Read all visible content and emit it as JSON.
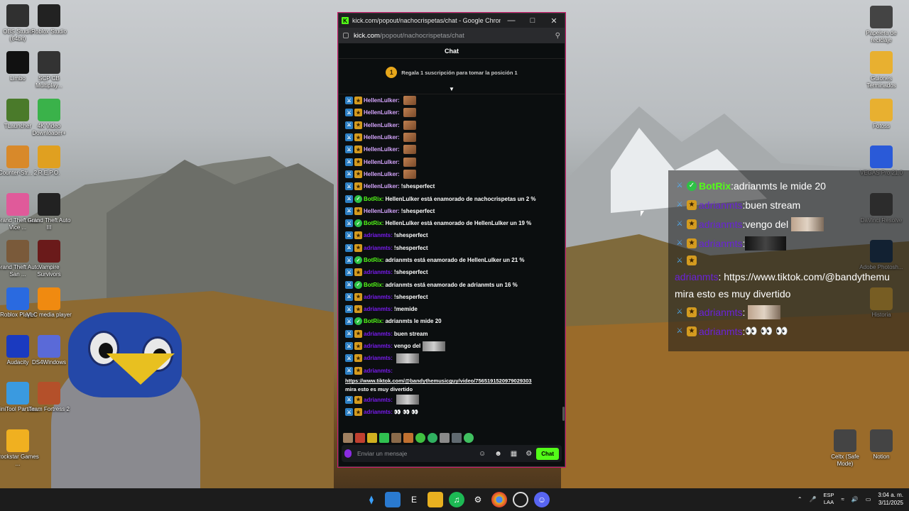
{
  "desktop_icons": [
    {
      "label": "OBS Studio (64bit)",
      "icon": "obs-icon",
      "color": "#303030"
    },
    {
      "label": "Roblox Studio",
      "icon": "roblox-studio-icon",
      "color": "#222"
    },
    {
      "label": "Limbo",
      "icon": "limbo-icon",
      "color": "#111"
    },
    {
      "label": "SCP CB Multiplay...",
      "icon": "scp-icon",
      "color": "#333"
    },
    {
      "label": "TLauncher",
      "icon": "tlauncher-icon",
      "color": "#4a7a2a"
    },
    {
      "label": "4K Video Downloader+",
      "icon": "4k-video-icon",
      "color": "#3ab24a"
    },
    {
      "label": "Counter-Str... 2",
      "icon": "counter-strike-icon",
      "color": "#d8892a"
    },
    {
      "label": "R.E.P.O.",
      "icon": "repo-icon",
      "color": "#e0a020"
    },
    {
      "label": "Grand Theft Auto Vice ...",
      "icon": "gta-vice-icon",
      "color": "#e05a9a"
    },
    {
      "label": "Grand Theft Auto III",
      "icon": "gta-3-icon",
      "color": "#222"
    },
    {
      "label": "Grand Theft Auto San ...",
      "icon": "gta-sa-icon",
      "color": "#7a5a3a"
    },
    {
      "label": "Vampire Survivors",
      "icon": "vampire-survivors-icon",
      "color": "#6a1a1a"
    },
    {
      "label": "Roblox Player",
      "icon": "roblox-player-icon",
      "color": "#2a6ae0"
    },
    {
      "label": "VLC media player",
      "icon": "vlc-icon",
      "color": "#f08a10"
    },
    {
      "label": "Audacity",
      "icon": "audacity-icon",
      "color": "#1a3ac0"
    },
    {
      "label": "DS4Windows",
      "icon": "ds4windows-icon",
      "color": "#5a6ad8"
    },
    {
      "label": "MiniTool Partitio...",
      "icon": "minitool-icon",
      "color": "#3a9ae0"
    },
    {
      "label": "Team Fortress 2",
      "icon": "tf2-icon",
      "color": "#b4502a"
    },
    {
      "label": "Rockstar Games ...",
      "icon": "rockstar-icon",
      "color": "#f0b020"
    }
  ],
  "right_icons": [
    {
      "label": "Papelera de reciclaje",
      "icon": "recycle-bin-icon"
    },
    {
      "label": "Guiones Terminados",
      "icon": "folder-icon"
    },
    {
      "label": "Fotoss",
      "icon": "folder-icon"
    },
    {
      "label": "VEGAS Pro 21.0",
      "icon": "vegas-icon"
    },
    {
      "label": "DaVinci Resolve",
      "icon": "davinci-icon"
    },
    {
      "label": "Adobe Photosh...",
      "icon": "photoshop-icon"
    },
    {
      "label": "Historia",
      "icon": "folder-icon"
    },
    {
      "label": "Celtx (Safe Mode)",
      "icon": "celtx-icon"
    },
    {
      "label": "Notion",
      "icon": "notion-icon"
    }
  ],
  "browser": {
    "title": "kick.com/popout/nachocrispetas/chat - Google Chrome",
    "url_domain": "kick.com",
    "url_path": "/popout/nachocrispetas/chat",
    "chat_header": "Chat",
    "promo_rank": "1",
    "promo_text": "Regala 1 suscripción para tomar la posición 1",
    "input_placeholder": "Enviar un mensaje",
    "send_label": "Chat"
  },
  "chat_messages": [
    {
      "user": "HellenLulker",
      "type": "hel",
      "text": "",
      "emote": true
    },
    {
      "user": "HellenLulker",
      "type": "hel",
      "text": "",
      "emote": true
    },
    {
      "user": "HellenLulker",
      "type": "hel",
      "text": "",
      "emote": true
    },
    {
      "user": "HellenLulker",
      "type": "hel",
      "text": "",
      "emote": true
    },
    {
      "user": "HellenLulker",
      "type": "hel",
      "text": "",
      "emote": true
    },
    {
      "user": "HellenLulker",
      "type": "hel",
      "text": "",
      "emote": true
    },
    {
      "user": "HellenLulker",
      "type": "hel",
      "text": "",
      "emote": true
    },
    {
      "user": "HellenLulker",
      "type": "hel",
      "text": "!shesperfect"
    },
    {
      "user": "BotRix",
      "type": "bot",
      "text": "HellenLulker está enamorado de nachocrispetas un 2 %"
    },
    {
      "user": "HellenLulker",
      "type": "hel",
      "text": "!shesperfect"
    },
    {
      "user": "BotRix",
      "type": "bot",
      "text": "HellenLulker está enamorado de HellenLulker un 19 %"
    },
    {
      "user": "adrianmts",
      "type": "adr",
      "text": "!shesperfect"
    },
    {
      "user": "adrianmts",
      "type": "adr",
      "text": "!shesperfect"
    },
    {
      "user": "BotRix",
      "type": "bot",
      "text": "adrianmts está enamorado de HellenLulker un 21 %"
    },
    {
      "user": "adrianmts",
      "type": "adr",
      "text": "!shesperfect"
    },
    {
      "user": "BotRix",
      "type": "bot",
      "text": "adrianmts está enamorado de adrianmts un 16 %"
    },
    {
      "user": "adrianmts",
      "type": "adr",
      "text": "!shesperfect"
    },
    {
      "user": "adrianmts",
      "type": "adr",
      "text": "!memide"
    },
    {
      "user": "BotRix",
      "type": "bot",
      "text": "adrianmts le mide 20"
    },
    {
      "user": "adrianmts",
      "type": "adr",
      "text": "buen stream"
    },
    {
      "user": "adrianmts",
      "type": "adr",
      "text": "vengo del",
      "img": true
    },
    {
      "user": "adrianmts",
      "type": "adr",
      "text": "",
      "img": true
    }
  ],
  "link_message": {
    "user": "adrianmts",
    "link": "https://www.tiktok.com/@bandythemusicguy/video/7565191520979029303",
    "text": "mira esto es muy divertido"
  },
  "tail_messages": [
    {
      "user": "adrianmts",
      "type": "adr",
      "text": "",
      "img": true
    },
    {
      "user": "adrianmts",
      "type": "adr",
      "text": "👀 👀 👀"
    }
  ],
  "overlay": {
    "lines": [
      {
        "user": "BotRix",
        "type": "bot",
        "text": "adrianmts le mide 20"
      },
      {
        "user": "adrianmts",
        "type": "adr",
        "text": "buen stream"
      },
      {
        "user": "adrianmts",
        "type": "adr",
        "text": "vengo del",
        "img": true
      },
      {
        "user": "adrianmts",
        "type": "adr",
        "text": "",
        "img2": true
      }
    ],
    "link_user": "adrianmts",
    "link_text": "https://www.tiktok.com/@bandythemu",
    "link_followup": "mira esto es muy divertido",
    "tail": [
      {
        "user": "adrianmts",
        "type": "adr",
        "text": "",
        "img": true
      },
      {
        "user": "adrianmts",
        "type": "adr",
        "text": "👀 👀 👀"
      }
    ]
  },
  "taskbar": {
    "lang_top": "ESP",
    "lang_bottom": "LAA",
    "time": "3:04 a. m.",
    "date": "3/11/2025"
  },
  "colors": {
    "kick_green": "#53fc18",
    "popup_border": "#d01a6e",
    "hellen": "#d6a6ff",
    "adrian": "#7a1cf0"
  }
}
